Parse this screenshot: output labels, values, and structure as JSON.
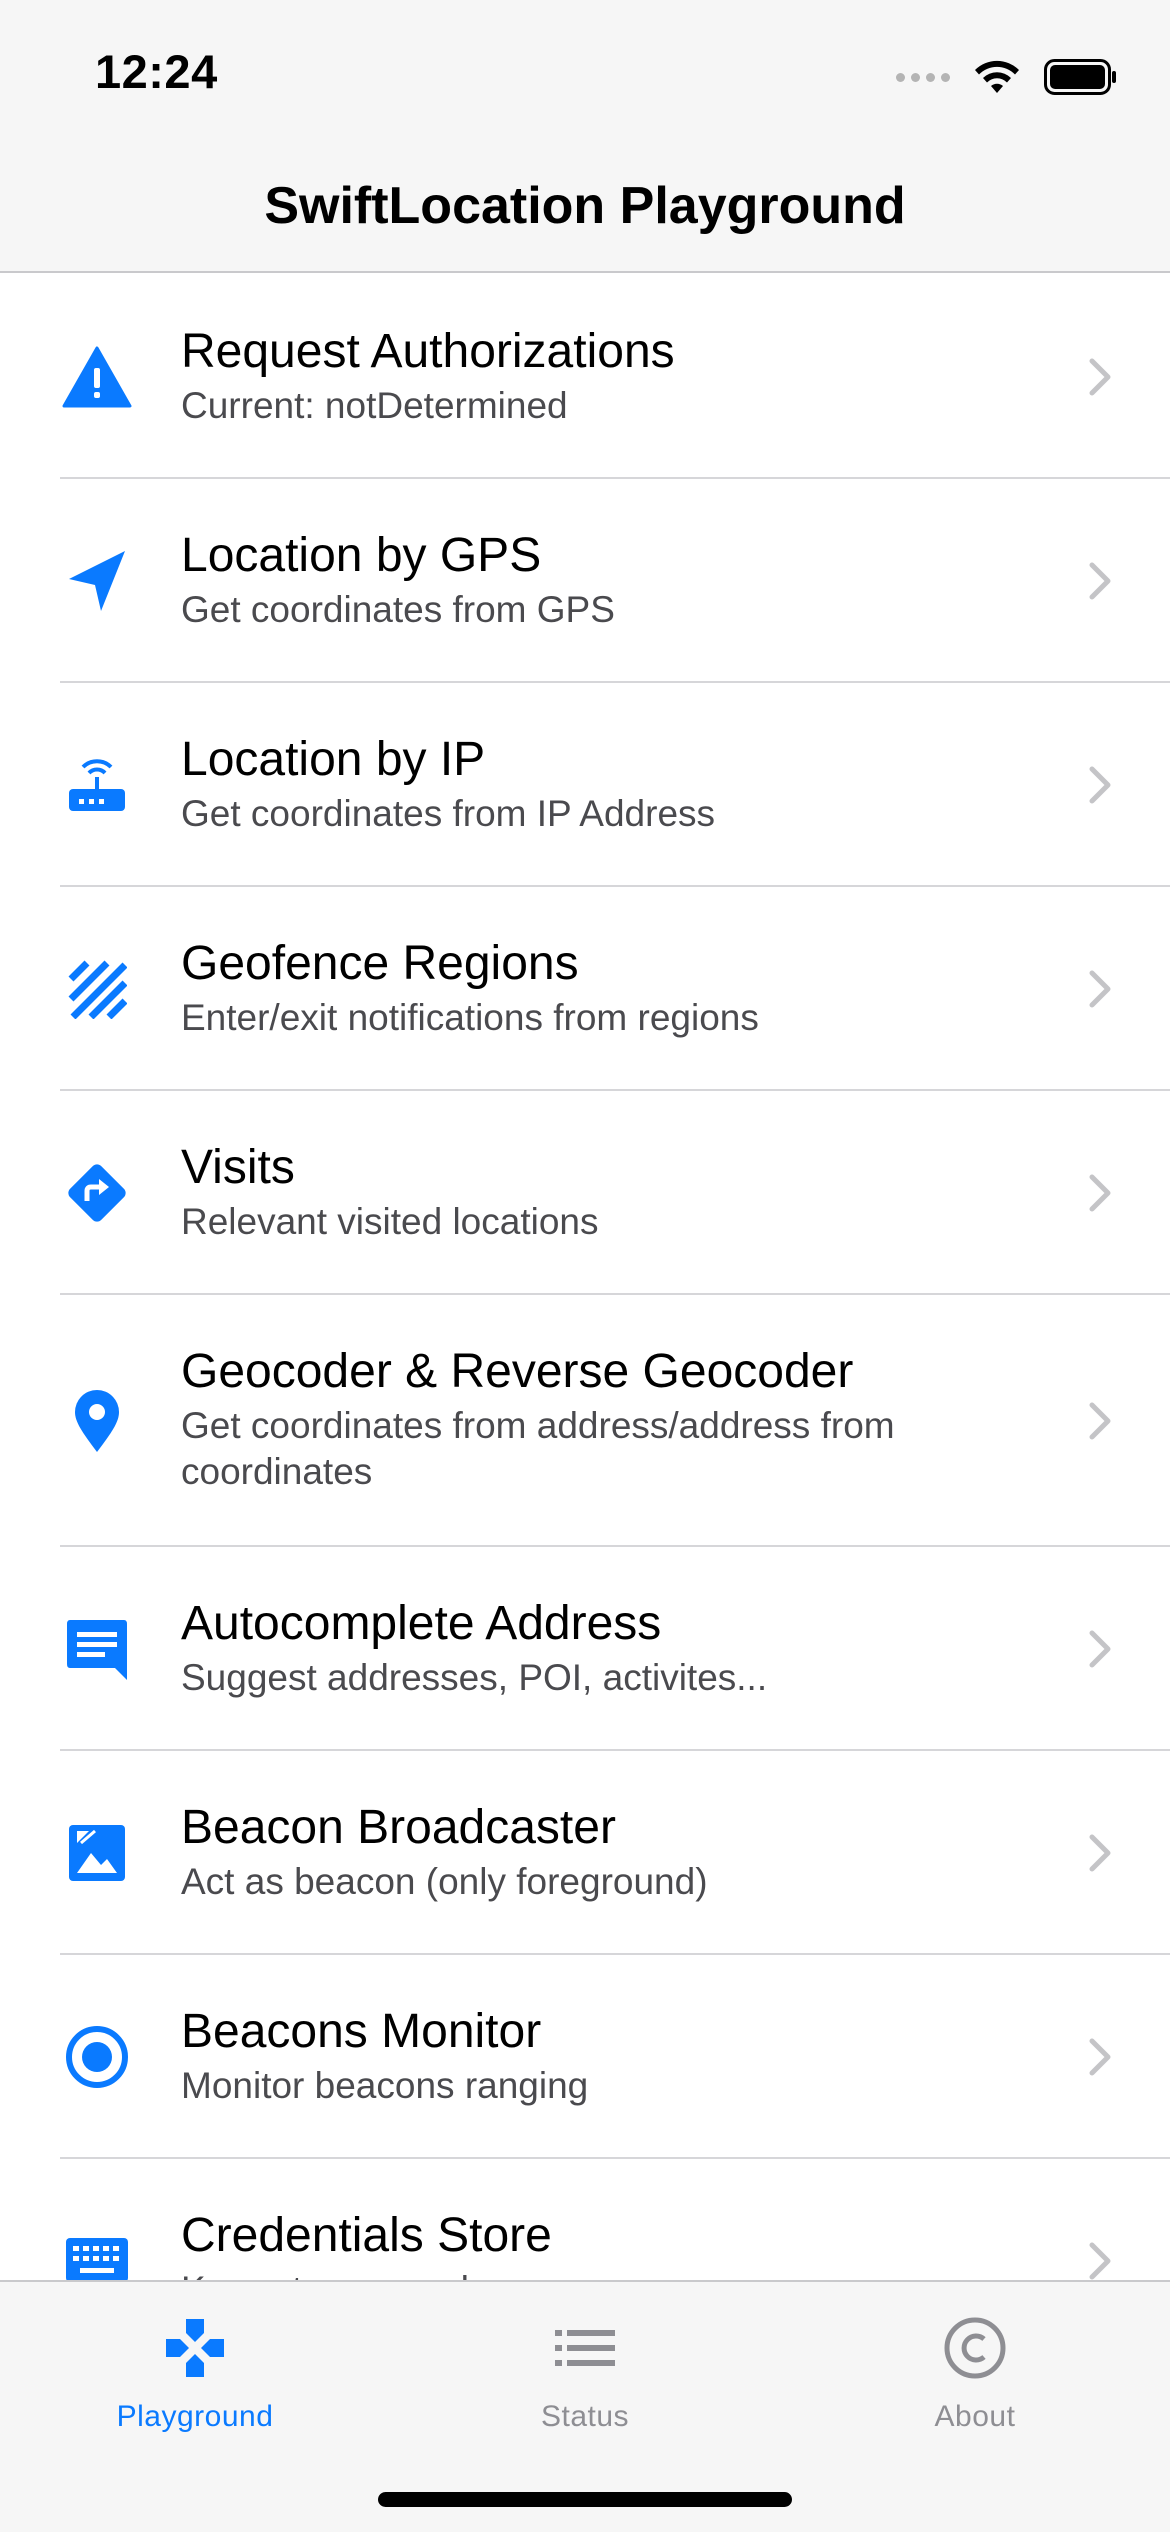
{
  "status_bar": {
    "time": "12:24"
  },
  "nav": {
    "title": "SwiftLocation Playground"
  },
  "colors": {
    "accent": "#0a7aff",
    "inactive": "#8e8e93",
    "subtitle": "#4a4a4e"
  },
  "items": [
    {
      "icon": "warning-icon",
      "title": "Request Authorizations",
      "subtitle": "Current: notDetermined"
    },
    {
      "icon": "location-arrow-icon",
      "title": "Location by GPS",
      "subtitle": "Get coordinates from GPS"
    },
    {
      "icon": "router-icon",
      "title": "Location by IP",
      "subtitle": "Get coordinates from IP Address"
    },
    {
      "icon": "striped-region-icon",
      "title": "Geofence Regions",
      "subtitle": "Enter/exit notifications from regions"
    },
    {
      "icon": "directions-icon",
      "title": "Visits",
      "subtitle": "Relevant visited locations"
    },
    {
      "icon": "map-pin-icon",
      "title": "Geocoder & Reverse Geocoder",
      "subtitle": "Get coordinates from address/address from coordinates"
    },
    {
      "icon": "message-icon",
      "title": "Autocomplete Address",
      "subtitle": "Suggest addresses, POI, activites..."
    },
    {
      "icon": "image-icon",
      "title": "Beacon Broadcaster",
      "subtitle": "Act as beacon (only foreground)"
    },
    {
      "icon": "radio-target-icon",
      "title": "Beacons Monitor",
      "subtitle": "Monitor beacons ranging"
    },
    {
      "icon": "keyboard-icon",
      "title": "Credentials Store",
      "subtitle": "Keys storage and ..."
    }
  ],
  "tabs": [
    {
      "icon": "gamepad-icon",
      "label": "Playground",
      "active": true
    },
    {
      "icon": "list-icon",
      "label": "Status",
      "active": false
    },
    {
      "icon": "copyright-icon",
      "label": "About",
      "active": false
    }
  ]
}
